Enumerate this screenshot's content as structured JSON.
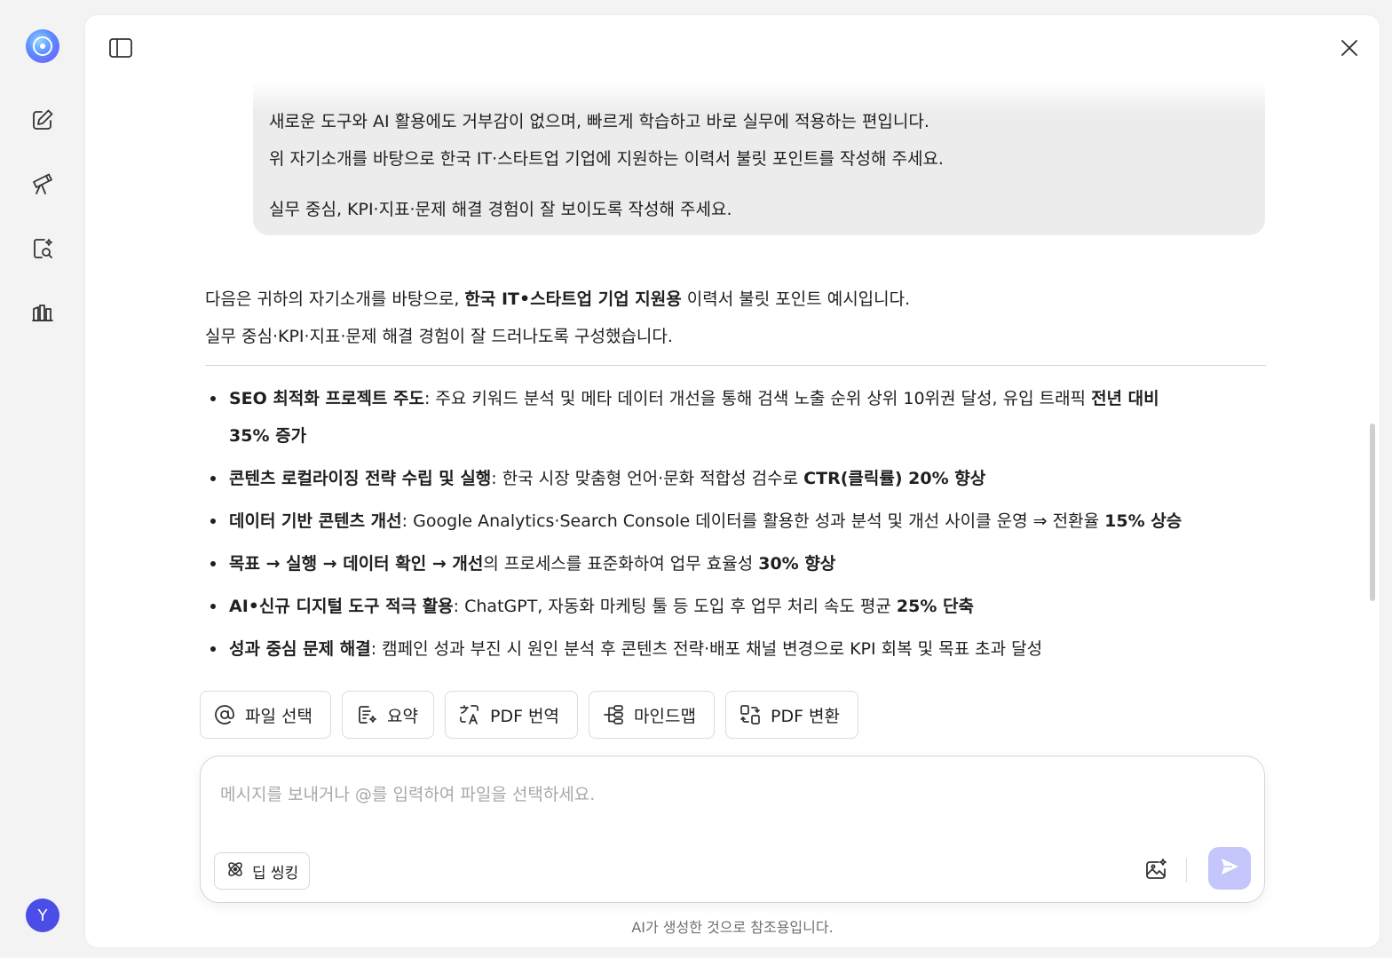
{
  "user_message": {
    "lines": [
      "새로운 도구와 AI 활용에도 거부감이 없으며, 빠르게 학습하고 바로 실무에 적용하는 편입니다.",
      "위 자기소개를 바탕으로 한국 IT·스타트업 기업에 지원하는 이력서 불릿 포인트를 작성해 주세요.",
      "실무 중심, KPI·지표·문제 해결 경험이 잘 보이도록 작성해 주세요."
    ]
  },
  "assistant": {
    "intro1_pre": "다음은 귀하의 자기소개를 바탕으로, ",
    "intro1_bold": "한국 IT•스타트업 기업 지원용",
    "intro1_post": " 이력서 불릿 포인트 예시입니다.",
    "intro2": "실무 중심·KPI·지표·문제 해결 경험이 잘 드러나도록 구성했습니다.",
    "bullets": [
      {
        "bold": "SEO 최적화 프로젝트 주도",
        "text": ": 주요 키워드 분석 및 메타 데이터 개선을 통해 검색 노출 순위 상위 10위권 달성, 유입 트래픽 ",
        "bold2": "전년 대비",
        "line2_bold": "35% 증가"
      },
      {
        "bold": "콘텐츠 로컬라이징 전략 수립 및 실행",
        "text": ": 한국 시장 맞춤형 언어·문화 적합성 검수로 ",
        "bold2": "CTR(클릭률) 20% 향상"
      },
      {
        "bold": "데이터 기반 콘텐츠 개선",
        "text": ": Google Analytics·Search Console 데이터를 활용한 성과 분석 및 개선 사이클 운영 ⇒ 전환율 ",
        "bold2": "15% 상승"
      },
      {
        "bold": "목표 → 실행 → 데이터 확인 → 개선",
        "text": "의 프로세스를 표준화하여 업무 효율성 ",
        "bold2": "30% 향상"
      },
      {
        "bold": "AI•신규 디지털 도구 적극 활용",
        "text": ": ChatGPT, 자동화 마케팅 툴 등 도입 후 업무 처리 속도 평균 ",
        "bold2": "25% 단축"
      },
      {
        "bold": "성과 중심 문제 해결",
        "text": ": 캠페인 성과 부진 시 원인 분석 후 콘텐츠 전략·배포 채널 변경으로 KPI 회복 및 목표 초과 달성",
        "bold2": ""
      }
    ]
  },
  "chips": [
    {
      "label": "파일 선택",
      "icon": "at-icon"
    },
    {
      "label": "요약",
      "icon": "summary-icon"
    },
    {
      "label": "PDF 번역",
      "icon": "translate-icon"
    },
    {
      "label": "마인드맵",
      "icon": "mindmap-icon"
    },
    {
      "label": "PDF 변환",
      "icon": "convert-icon"
    }
  ],
  "input": {
    "placeholder": "메시지를 보내거나 @를 입력하여 파일을 선택하세요.",
    "value": "",
    "deep_thinking_label": "딥 씽킹"
  },
  "footnote": "AI가 생성한 것으로 참조용입니다.",
  "avatar_letter": "Y",
  "colors": {
    "send_button": "#c4c6fb",
    "avatar": "#4a4de6",
    "bubble": "#ececec"
  }
}
